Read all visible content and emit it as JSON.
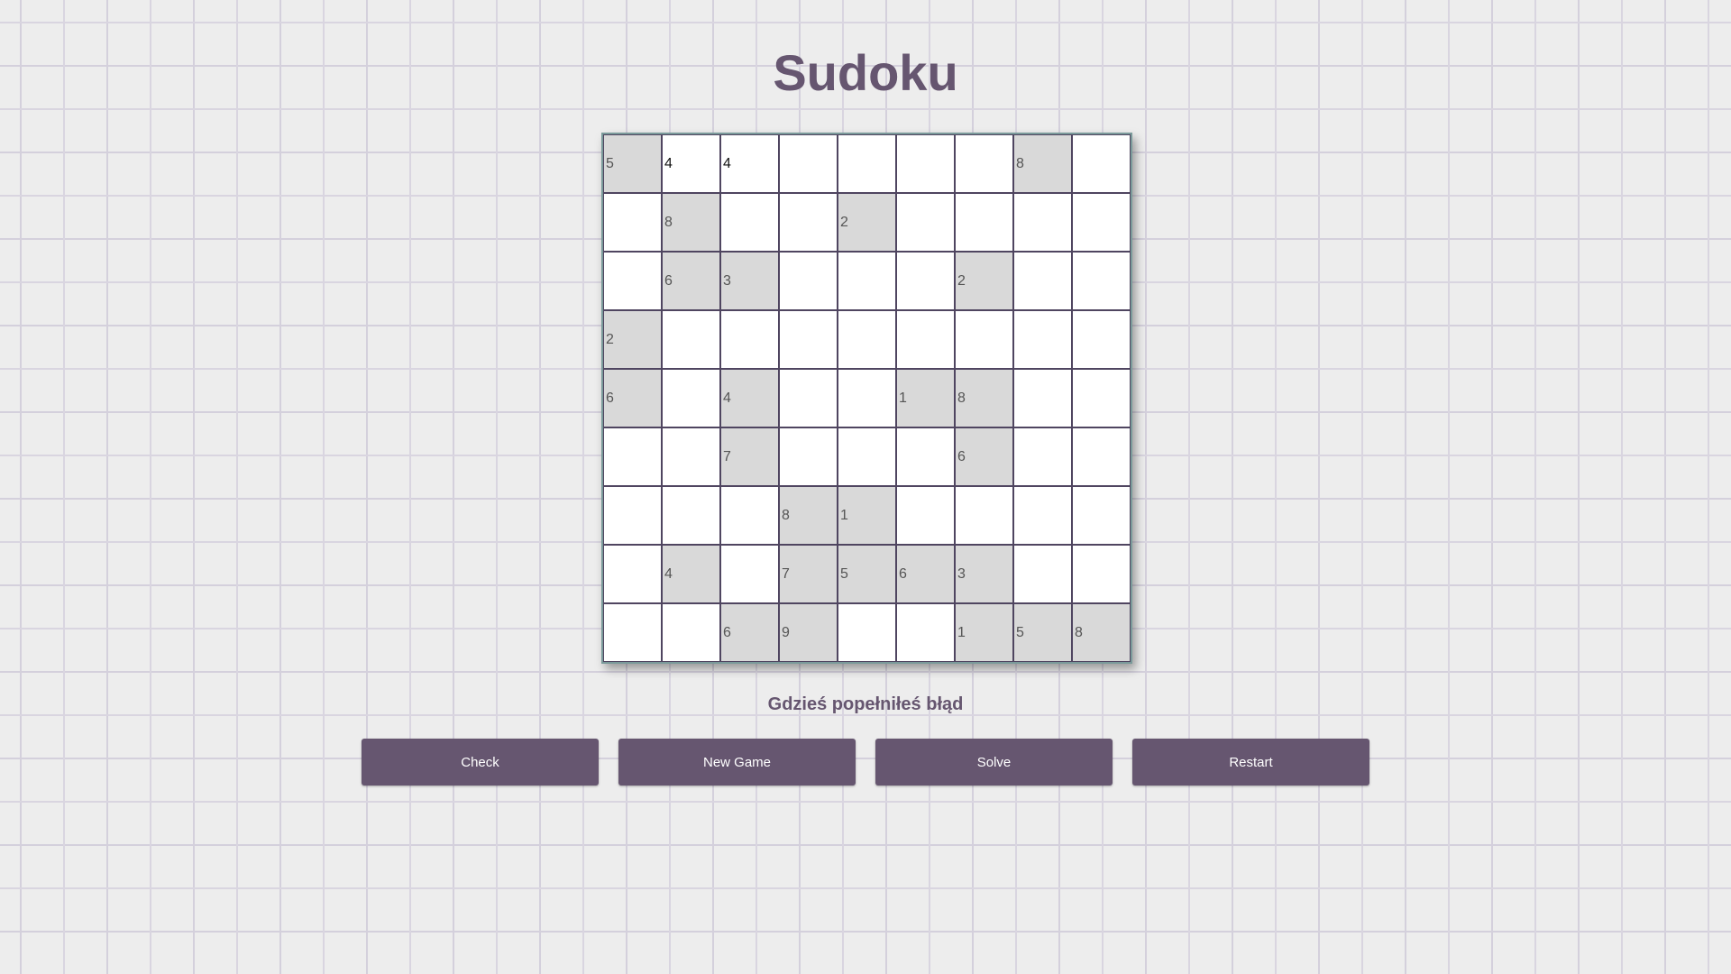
{
  "title": "Sudoku",
  "status": "Gdzieś popełniłeś błąd",
  "buttons": {
    "check": "Check",
    "new_game": "New Game",
    "solve": "Solve",
    "restart": "Restart"
  },
  "colors": {
    "accent": "#665670",
    "given_cell": "#d9d9d9",
    "cell": "#ffffff",
    "background": "#ededed"
  },
  "board": [
    [
      {
        "v": "5",
        "g": true
      },
      {
        "v": "4",
        "u": true
      },
      {
        "v": "4",
        "u": true
      },
      {
        "v": ""
      },
      {
        "v": ""
      },
      {
        "v": ""
      },
      {
        "v": ""
      },
      {
        "v": "8",
        "g": true
      },
      {
        "v": ""
      }
    ],
    [
      {
        "v": ""
      },
      {
        "v": "8",
        "g": true
      },
      {
        "v": ""
      },
      {
        "v": ""
      },
      {
        "v": "2",
        "g": true
      },
      {
        "v": ""
      },
      {
        "v": ""
      },
      {
        "v": ""
      },
      {
        "v": ""
      }
    ],
    [
      {
        "v": ""
      },
      {
        "v": "6",
        "g": true
      },
      {
        "v": "3",
        "g": true
      },
      {
        "v": ""
      },
      {
        "v": ""
      },
      {
        "v": ""
      },
      {
        "v": "2",
        "g": true
      },
      {
        "v": ""
      },
      {
        "v": ""
      }
    ],
    [
      {
        "v": "2",
        "g": true
      },
      {
        "v": ""
      },
      {
        "v": ""
      },
      {
        "v": ""
      },
      {
        "v": ""
      },
      {
        "v": ""
      },
      {
        "v": ""
      },
      {
        "v": ""
      },
      {
        "v": ""
      }
    ],
    [
      {
        "v": "6",
        "g": true
      },
      {
        "v": ""
      },
      {
        "v": "4",
        "g": true
      },
      {
        "v": ""
      },
      {
        "v": ""
      },
      {
        "v": "1",
        "g": true
      },
      {
        "v": "8",
        "g": true
      },
      {
        "v": ""
      },
      {
        "v": ""
      }
    ],
    [
      {
        "v": ""
      },
      {
        "v": ""
      },
      {
        "v": "7",
        "g": true
      },
      {
        "v": ""
      },
      {
        "v": ""
      },
      {
        "v": ""
      },
      {
        "v": "6",
        "g": true
      },
      {
        "v": ""
      },
      {
        "v": ""
      }
    ],
    [
      {
        "v": ""
      },
      {
        "v": ""
      },
      {
        "v": ""
      },
      {
        "v": "8",
        "g": true
      },
      {
        "v": "1",
        "g": true
      },
      {
        "v": ""
      },
      {
        "v": ""
      },
      {
        "v": ""
      },
      {
        "v": ""
      }
    ],
    [
      {
        "v": ""
      },
      {
        "v": "4",
        "g": true
      },
      {
        "v": ""
      },
      {
        "v": "7",
        "g": true
      },
      {
        "v": "5",
        "g": true
      },
      {
        "v": "6",
        "g": true
      },
      {
        "v": "3",
        "g": true
      },
      {
        "v": ""
      },
      {
        "v": ""
      }
    ],
    [
      {
        "v": ""
      },
      {
        "v": ""
      },
      {
        "v": "6",
        "g": true
      },
      {
        "v": "9",
        "g": true
      },
      {
        "v": ""
      },
      {
        "v": ""
      },
      {
        "v": "1",
        "g": true
      },
      {
        "v": "5",
        "g": true
      },
      {
        "v": "8",
        "g": true
      }
    ]
  ]
}
